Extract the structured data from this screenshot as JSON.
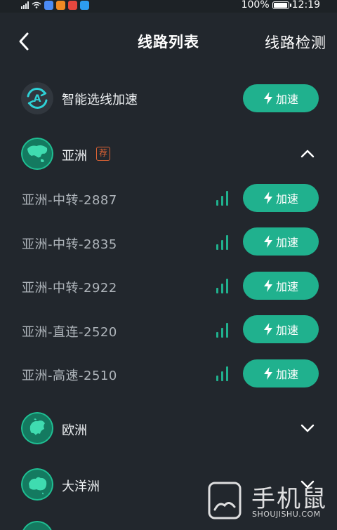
{
  "status_bar": {
    "battery": "100%",
    "time": "12:19",
    "battery_level": 1.0
  },
  "header": {
    "title": "线路列表",
    "detect_label": "线路检测"
  },
  "smart": {
    "label": "智能选线加速",
    "button": "加速"
  },
  "regions": [
    {
      "name": "亚洲",
      "tag": "荐",
      "expanded": true
    },
    {
      "name": "欧洲",
      "expanded": false
    },
    {
      "name": "大洋洲",
      "expanded": false
    }
  ],
  "routes": [
    {
      "name": "亚洲-中转-2887",
      "button": "加速"
    },
    {
      "name": "亚洲-中转-2835",
      "button": "加速"
    },
    {
      "name": "亚洲-中转-2922",
      "button": "加速"
    },
    {
      "name": "亚洲-直连-2520",
      "button": "加速"
    },
    {
      "name": "亚洲-高速-2510",
      "button": "加速"
    }
  ],
  "watermark": {
    "text": "手机鼠",
    "sub": "SHOUJISHU.COM"
  },
  "colors": {
    "background": "#22272d",
    "accent": "#20b18e",
    "tag": "#e06434"
  },
  "icons": {
    "back": "chevron-left-icon",
    "boost": "lightning-icon",
    "signal": "signal-strength-icon",
    "expand": "chevron-down-icon",
    "collapse": "chevron-up-icon"
  }
}
